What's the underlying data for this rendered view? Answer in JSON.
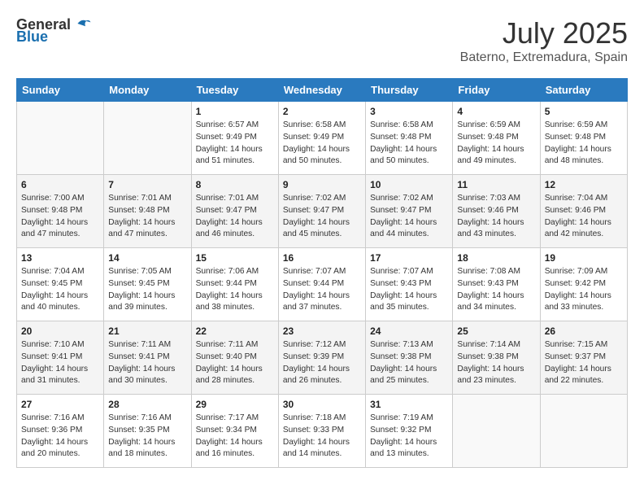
{
  "header": {
    "logo_general": "General",
    "logo_blue": "Blue",
    "month": "July 2025",
    "location": "Baterno, Extremadura, Spain"
  },
  "days_of_week": [
    "Sunday",
    "Monday",
    "Tuesday",
    "Wednesday",
    "Thursday",
    "Friday",
    "Saturday"
  ],
  "weeks": [
    [
      {
        "day": "",
        "content": ""
      },
      {
        "day": "",
        "content": ""
      },
      {
        "day": "1",
        "content": "Sunrise: 6:57 AM\nSunset: 9:49 PM\nDaylight: 14 hours and 51 minutes."
      },
      {
        "day": "2",
        "content": "Sunrise: 6:58 AM\nSunset: 9:49 PM\nDaylight: 14 hours and 50 minutes."
      },
      {
        "day": "3",
        "content": "Sunrise: 6:58 AM\nSunset: 9:48 PM\nDaylight: 14 hours and 50 minutes."
      },
      {
        "day": "4",
        "content": "Sunrise: 6:59 AM\nSunset: 9:48 PM\nDaylight: 14 hours and 49 minutes."
      },
      {
        "day": "5",
        "content": "Sunrise: 6:59 AM\nSunset: 9:48 PM\nDaylight: 14 hours and 48 minutes."
      }
    ],
    [
      {
        "day": "6",
        "content": "Sunrise: 7:00 AM\nSunset: 9:48 PM\nDaylight: 14 hours and 47 minutes."
      },
      {
        "day": "7",
        "content": "Sunrise: 7:01 AM\nSunset: 9:48 PM\nDaylight: 14 hours and 47 minutes."
      },
      {
        "day": "8",
        "content": "Sunrise: 7:01 AM\nSunset: 9:47 PM\nDaylight: 14 hours and 46 minutes."
      },
      {
        "day": "9",
        "content": "Sunrise: 7:02 AM\nSunset: 9:47 PM\nDaylight: 14 hours and 45 minutes."
      },
      {
        "day": "10",
        "content": "Sunrise: 7:02 AM\nSunset: 9:47 PM\nDaylight: 14 hours and 44 minutes."
      },
      {
        "day": "11",
        "content": "Sunrise: 7:03 AM\nSunset: 9:46 PM\nDaylight: 14 hours and 43 minutes."
      },
      {
        "day": "12",
        "content": "Sunrise: 7:04 AM\nSunset: 9:46 PM\nDaylight: 14 hours and 42 minutes."
      }
    ],
    [
      {
        "day": "13",
        "content": "Sunrise: 7:04 AM\nSunset: 9:45 PM\nDaylight: 14 hours and 40 minutes."
      },
      {
        "day": "14",
        "content": "Sunrise: 7:05 AM\nSunset: 9:45 PM\nDaylight: 14 hours and 39 minutes."
      },
      {
        "day": "15",
        "content": "Sunrise: 7:06 AM\nSunset: 9:44 PM\nDaylight: 14 hours and 38 minutes."
      },
      {
        "day": "16",
        "content": "Sunrise: 7:07 AM\nSunset: 9:44 PM\nDaylight: 14 hours and 37 minutes."
      },
      {
        "day": "17",
        "content": "Sunrise: 7:07 AM\nSunset: 9:43 PM\nDaylight: 14 hours and 35 minutes."
      },
      {
        "day": "18",
        "content": "Sunrise: 7:08 AM\nSunset: 9:43 PM\nDaylight: 14 hours and 34 minutes."
      },
      {
        "day": "19",
        "content": "Sunrise: 7:09 AM\nSunset: 9:42 PM\nDaylight: 14 hours and 33 minutes."
      }
    ],
    [
      {
        "day": "20",
        "content": "Sunrise: 7:10 AM\nSunset: 9:41 PM\nDaylight: 14 hours and 31 minutes."
      },
      {
        "day": "21",
        "content": "Sunrise: 7:11 AM\nSunset: 9:41 PM\nDaylight: 14 hours and 30 minutes."
      },
      {
        "day": "22",
        "content": "Sunrise: 7:11 AM\nSunset: 9:40 PM\nDaylight: 14 hours and 28 minutes."
      },
      {
        "day": "23",
        "content": "Sunrise: 7:12 AM\nSunset: 9:39 PM\nDaylight: 14 hours and 26 minutes."
      },
      {
        "day": "24",
        "content": "Sunrise: 7:13 AM\nSunset: 9:38 PM\nDaylight: 14 hours and 25 minutes."
      },
      {
        "day": "25",
        "content": "Sunrise: 7:14 AM\nSunset: 9:38 PM\nDaylight: 14 hours and 23 minutes."
      },
      {
        "day": "26",
        "content": "Sunrise: 7:15 AM\nSunset: 9:37 PM\nDaylight: 14 hours and 22 minutes."
      }
    ],
    [
      {
        "day": "27",
        "content": "Sunrise: 7:16 AM\nSunset: 9:36 PM\nDaylight: 14 hours and 20 minutes."
      },
      {
        "day": "28",
        "content": "Sunrise: 7:16 AM\nSunset: 9:35 PM\nDaylight: 14 hours and 18 minutes."
      },
      {
        "day": "29",
        "content": "Sunrise: 7:17 AM\nSunset: 9:34 PM\nDaylight: 14 hours and 16 minutes."
      },
      {
        "day": "30",
        "content": "Sunrise: 7:18 AM\nSunset: 9:33 PM\nDaylight: 14 hours and 14 minutes."
      },
      {
        "day": "31",
        "content": "Sunrise: 7:19 AM\nSunset: 9:32 PM\nDaylight: 14 hours and 13 minutes."
      },
      {
        "day": "",
        "content": ""
      },
      {
        "day": "",
        "content": ""
      }
    ]
  ]
}
